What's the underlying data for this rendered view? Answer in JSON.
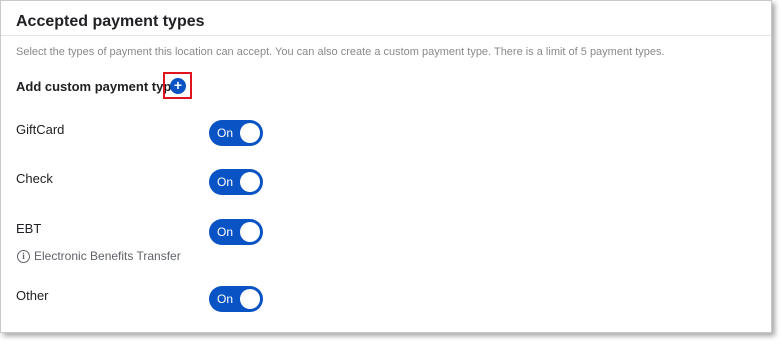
{
  "section": {
    "title": "Accepted payment types",
    "description": "Select the types of payment this location can accept. You can also create a custom payment type. There is a limit of 5 payment types.",
    "add_custom_label": "Add custom payment type",
    "add_button_glyph": "+"
  },
  "payment_types": [
    {
      "label": "GiftCard",
      "toggle_label": "On",
      "enabled": true
    },
    {
      "label": "Check",
      "toggle_label": "On",
      "enabled": true
    },
    {
      "label": "EBT",
      "toggle_label": "On",
      "enabled": true,
      "hint": "Electronic Benefits Transfer",
      "hint_icon": "info-icon"
    },
    {
      "label": "Other",
      "toggle_label": "On",
      "enabled": true
    }
  ],
  "colors": {
    "accent": "#0a53c4",
    "highlight": "#e0141e"
  }
}
